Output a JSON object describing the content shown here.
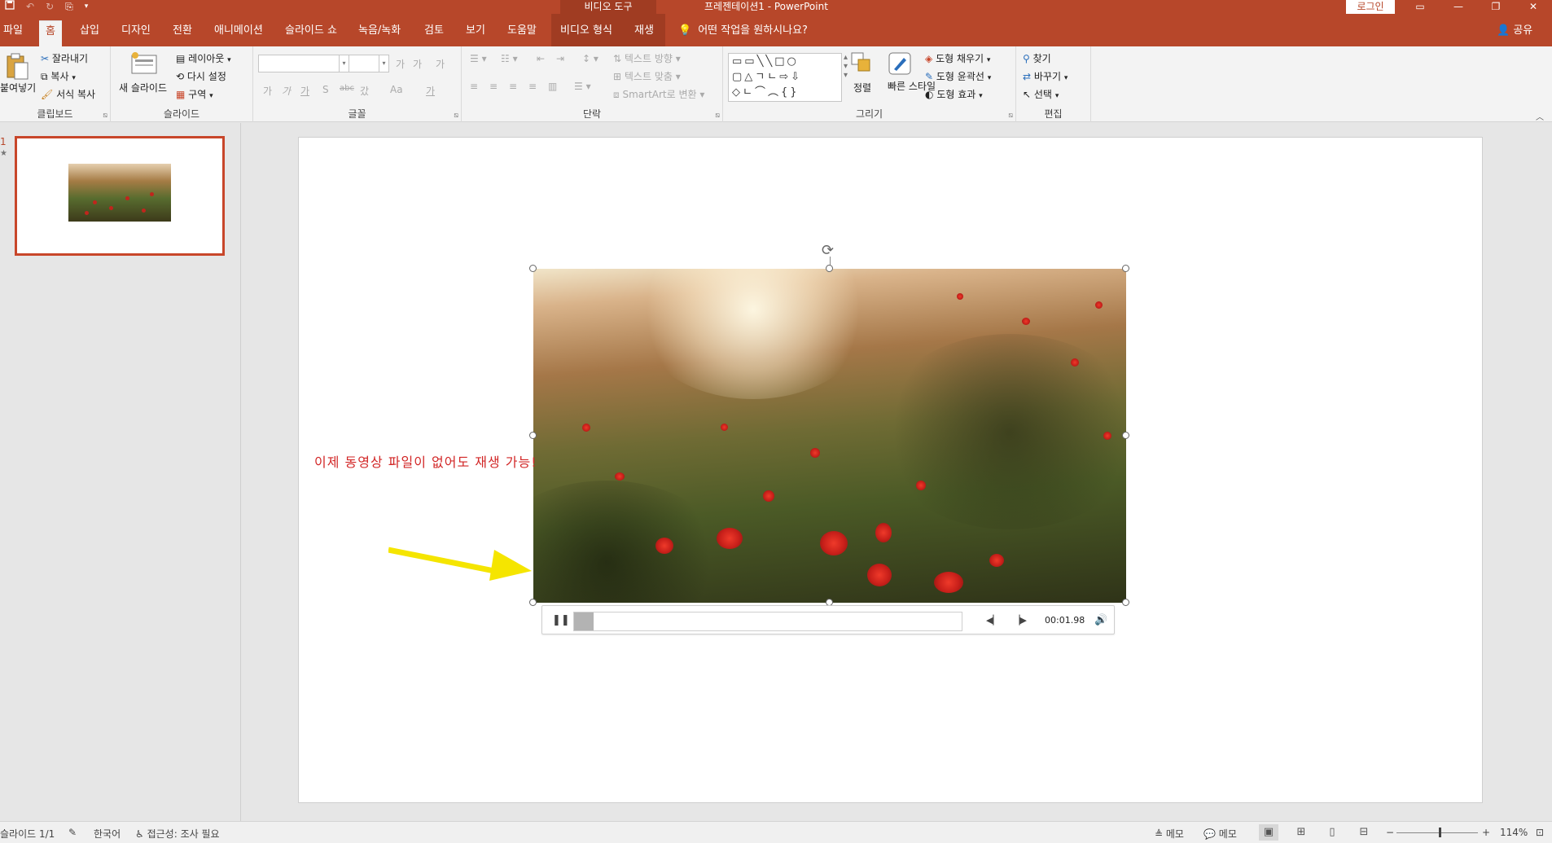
{
  "titlebar": {
    "qat_icons": [
      "save-icon",
      "undo-icon",
      "redo-icon",
      "presentation-icon",
      "customize-icon"
    ],
    "context_title": "비디오 도구",
    "doc_title": "프레젠테이션1  -  PowerPoint",
    "login": "로그인"
  },
  "tabs": {
    "file": "파일",
    "home": "홈",
    "insert": "삽입",
    "design": "디자인",
    "transitions": "전환",
    "animations": "애니메이션",
    "slideshow": "슬라이드 쇼",
    "record": "녹음/녹화",
    "review": "검토",
    "view": "보기",
    "help": "도움말",
    "video_format": "비디오 형식",
    "playback": "재생",
    "tell_me": "어떤 작업을 원하시나요?",
    "share": "공유"
  },
  "ribbon": {
    "clipboard": {
      "paste": "붙여넣기",
      "cut": "잘라내기",
      "copy": "복사",
      "format_painter": "서식 복사",
      "label": "클립보드"
    },
    "slides": {
      "new_slide": "새 슬라이드",
      "layout": "레이아웃",
      "reset": "다시 설정",
      "section": "구역",
      "label": "슬라이드"
    },
    "font": {
      "label": "글꼴",
      "grow": "가",
      "shrink": "가",
      "clear": "가",
      "bold": "가",
      "italic": "가",
      "underline": "가",
      "shadow": "S",
      "strike": "abc",
      "spacing": "갔",
      "case": "Aa",
      "color": "가"
    },
    "paragraph": {
      "text_direction": "텍스트 방향",
      "align_text": "텍스트 맞춤",
      "smartart": "SmartArt로 변환",
      "label": "단락"
    },
    "drawing": {
      "arrange": "정렬",
      "quick_styles": "빠른 스타일",
      "fill": "도형 채우기",
      "outline": "도형 윤곽선",
      "effects": "도형 효과",
      "label": "그리기"
    },
    "editing": {
      "find": "찾기",
      "replace": "바꾸기",
      "select": "선택",
      "label": "편집"
    }
  },
  "thumbnails": {
    "slide_number": "1",
    "star": "★"
  },
  "slide": {
    "annotation": "이제 동영상 파일이 없어도 재생 가능!",
    "player": {
      "time": "00:01.98",
      "progress": 0.05
    }
  },
  "statusbar": {
    "slide_info": "슬라이드 1/1",
    "language": "한국어",
    "accessibility": "접근성: 조사 필요",
    "notes": "메모",
    "comments": "메모",
    "zoom": "114%"
  },
  "colors": {
    "accent": "#b7472a",
    "annotation": "#d22626",
    "arrow": "#f5e500"
  }
}
